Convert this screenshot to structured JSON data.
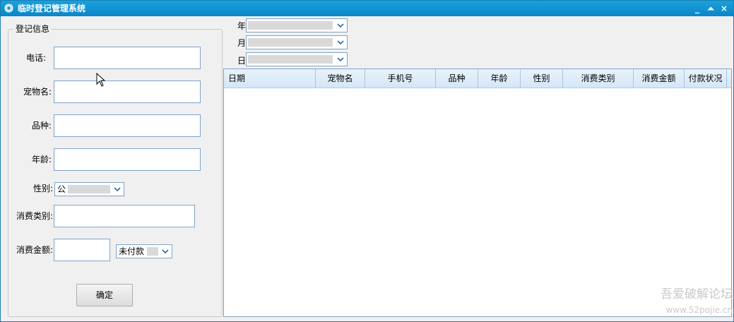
{
  "window": {
    "title": "临时登记管理系统",
    "buttons": {
      "minimize": "_",
      "maximize": "⏶",
      "close": "×"
    }
  },
  "form": {
    "group_title": "登记信息",
    "phone_label": "电话:",
    "pet_name_label": "宠物名:",
    "breed_label": "品种:",
    "age_label": "年龄:",
    "gender_label": "性别:",
    "gender_value": "公",
    "category_label": "消费类别:",
    "amount_label": "消费金额:",
    "payment_status_value": "未付款",
    "confirm_label": "确定"
  },
  "date_filter": {
    "year_label": "年",
    "month_label": "月",
    "day_label": "日"
  },
  "table": {
    "columns": [
      "日期",
      "宠物名",
      "手机号",
      "品种",
      "年龄",
      "性别",
      "消费类别",
      "消费金额",
      "付款状况"
    ],
    "rows": []
  },
  "watermark": {
    "line1": "吾爱破解论坛",
    "line2": "www.52pojie.cn"
  },
  "colors": {
    "titlebar": "#0b86c8",
    "header_bg": "#d3e6f7",
    "input_border": "#7fa3c7"
  }
}
